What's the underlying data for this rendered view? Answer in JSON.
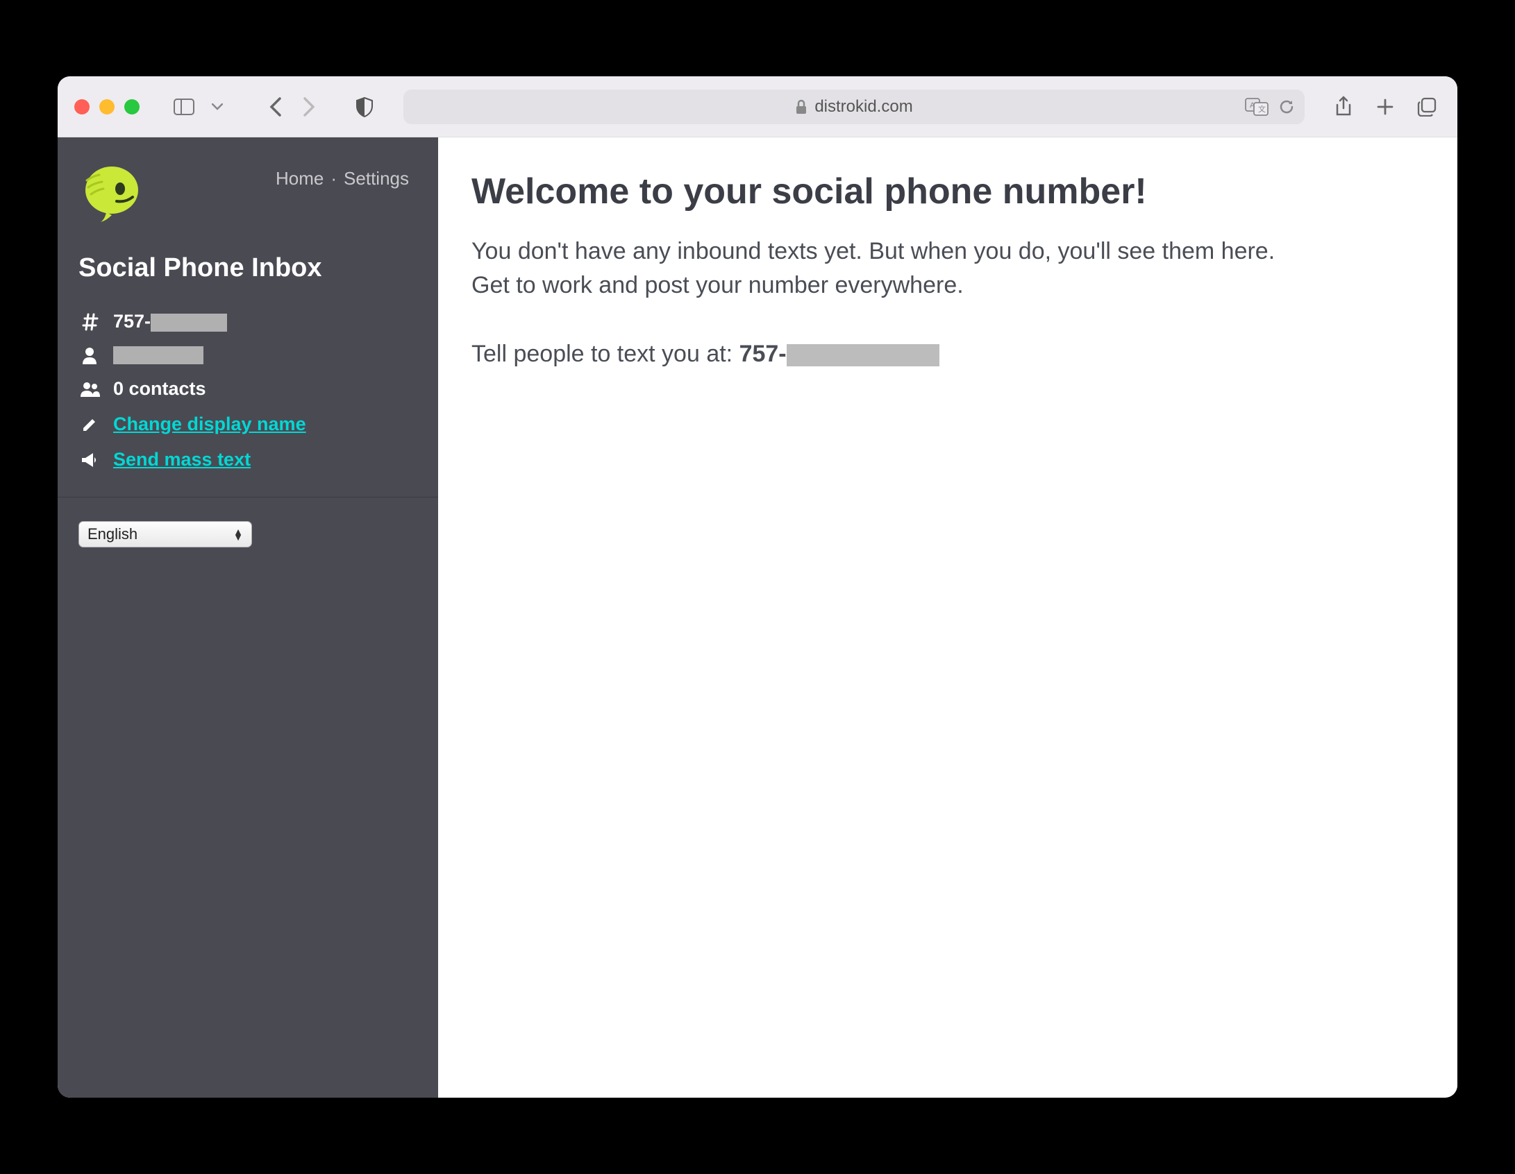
{
  "browser": {
    "url_domain": "distrokid.com"
  },
  "sidebar": {
    "nav": {
      "home": "Home",
      "separator": "·",
      "settings": "Settings"
    },
    "title": "Social Phone Inbox",
    "phone_prefix": "757-",
    "contacts_label": "0 contacts",
    "change_name_label": "Change display name",
    "send_mass_label": "Send mass text",
    "language_selected": "English"
  },
  "main": {
    "title": "Welcome to your social phone number!",
    "body": "You don't have any inbound texts yet. But when you do, you'll see them here. Get to work and post your number everywhere.",
    "cta_prefix": "Tell people to text you at: ",
    "cta_phone_prefix": "757-"
  }
}
